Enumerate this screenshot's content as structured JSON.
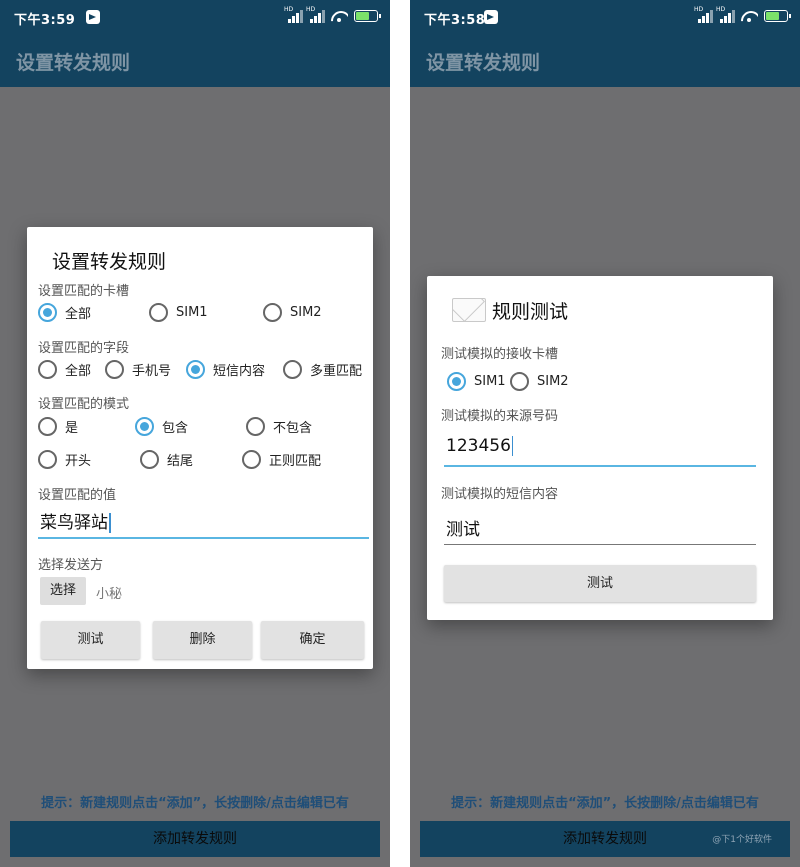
{
  "left": {
    "status": {
      "time": "下午3:59"
    },
    "appbar_title": "设置转发规则",
    "dialog": {
      "title": "设置转发规则",
      "card_slot": {
        "label": "设置匹配的卡槽",
        "options": [
          "全部",
          "SIM1",
          "SIM2"
        ],
        "selected": "全部"
      },
      "field": {
        "label": "设置匹配的字段",
        "options": [
          "全部",
          "手机号",
          "短信内容",
          "多重匹配"
        ],
        "selected": "短信内容"
      },
      "mode": {
        "label": "设置匹配的模式",
        "options": [
          "是",
          "包含",
          "不包含",
          "开头",
          "结尾",
          "正则匹配"
        ],
        "selected": "包含"
      },
      "value": {
        "label": "设置匹配的值",
        "text": "菜鸟驿站"
      },
      "sender": {
        "label": "选择发送方",
        "button": "选择",
        "current": "小秘"
      },
      "buttons": {
        "test": "测试",
        "delete": "删除",
        "confirm": "确定"
      }
    },
    "hint": "提示：新建规则点击“添加”，长按删除/点击编辑已有",
    "bottom_button": "添加转发规则"
  },
  "right": {
    "status": {
      "time": "下午3:58"
    },
    "appbar_title": "设置转发规则",
    "dialog": {
      "title": "规则测试",
      "icon": "envelope-icon",
      "card_slot": {
        "label": "测试模拟的接收卡槽",
        "options": [
          "SIM1",
          "SIM2"
        ],
        "selected": "SIM1"
      },
      "source": {
        "label": "测试模拟的来源号码",
        "text": "123456"
      },
      "content": {
        "label": "测试模拟的短信内容",
        "text": "测试"
      },
      "test_button": "测试"
    },
    "hint": "提示：新建规则点击“添加”，长按删除/点击编辑已有",
    "bottom_button": "添加转发规则",
    "watermark": "@下1个好软件"
  },
  "colors": {
    "bar": "#13435f",
    "accent": "#46a6dc",
    "overlay": "#6e6e70"
  }
}
